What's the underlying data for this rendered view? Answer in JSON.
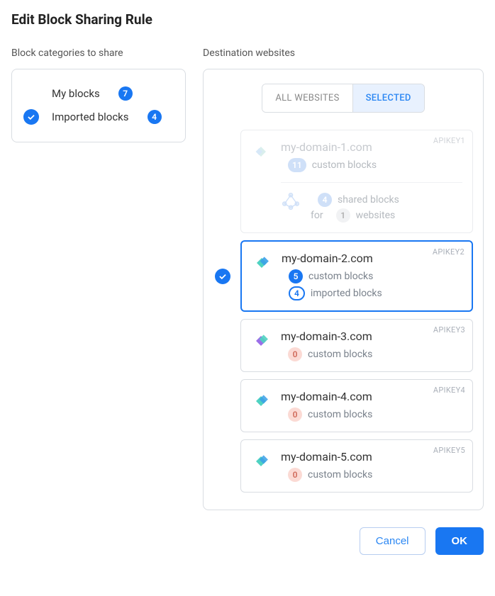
{
  "title": "Edit Block Sharing Rule",
  "left": {
    "section_label": "Block categories to share",
    "categories": [
      {
        "checked": false,
        "label": "My blocks",
        "count": 7
      },
      {
        "checked": true,
        "label": "Imported blocks",
        "count": 4
      }
    ]
  },
  "right": {
    "section_label": "Destination websites",
    "tabs": {
      "all": "ALL WEBSITES",
      "selected": "SELECTED"
    },
    "sites": [
      {
        "api_key": "APIKEY1",
        "domain": "my-domain-1.com",
        "custom_count": 11,
        "custom_label": "custom blocks",
        "disabled": true,
        "selected": false,
        "shared": {
          "count": 4,
          "label": "shared blocks",
          "for_prefix": "for",
          "for_count": 1,
          "for_label": "websites"
        }
      },
      {
        "api_key": "APIKEY2",
        "domain": "my-domain-2.com",
        "custom_count": 5,
        "custom_label": "custom blocks",
        "imported_count": 4,
        "imported_label": "imported blocks",
        "disabled": false,
        "selected": true
      },
      {
        "api_key": "APIKEY3",
        "domain": "my-domain-3.com",
        "custom_count": 0,
        "custom_label": "custom blocks",
        "disabled": false,
        "selected": false
      },
      {
        "api_key": "APIKEY4",
        "domain": "my-domain-4.com",
        "custom_count": 0,
        "custom_label": "custom blocks",
        "disabled": false,
        "selected": false
      },
      {
        "api_key": "APIKEY5",
        "domain": "my-domain-5.com",
        "custom_count": 0,
        "custom_label": "custom blocks",
        "disabled": false,
        "selected": false
      }
    ]
  },
  "actions": {
    "cancel": "Cancel",
    "ok": "OK"
  },
  "colors": {
    "primary": "#1977f2"
  }
}
